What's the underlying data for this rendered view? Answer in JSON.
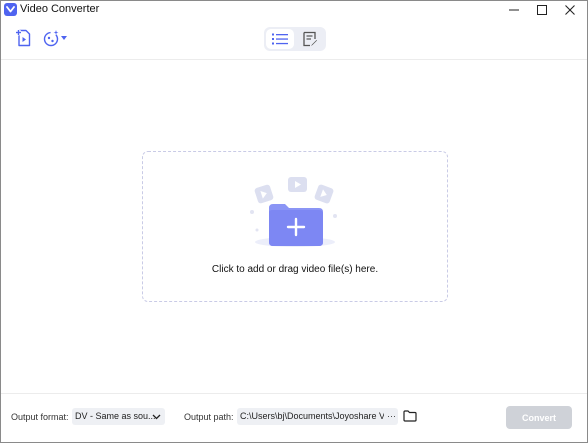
{
  "window": {
    "title": "Video Converter",
    "controls": {
      "minimize": "—",
      "maximize": "☐",
      "close": "✕"
    }
  },
  "toolbar": {
    "add_file_icon": "add-file-icon",
    "effect_icon": "effect-icon",
    "view_modes": [
      "list-view-icon",
      "task-view-icon"
    ],
    "active_view": "list-view-icon"
  },
  "dropzone": {
    "text": "Click to add or drag video file(s) here.",
    "icon": "add-folder-icon"
  },
  "bottom": {
    "format_label": "Output format:",
    "format_value": "DV - Same as sou...",
    "path_label": "Output path:",
    "path_value": "C:\\Users\\bj\\Documents\\Joyoshare VidiK",
    "path_more": "···",
    "convert_label": "Convert"
  },
  "colors": {
    "accent": "#4f64f0",
    "accent_light": "#8b95f5",
    "convert_disabled": "#cfd2d8"
  }
}
